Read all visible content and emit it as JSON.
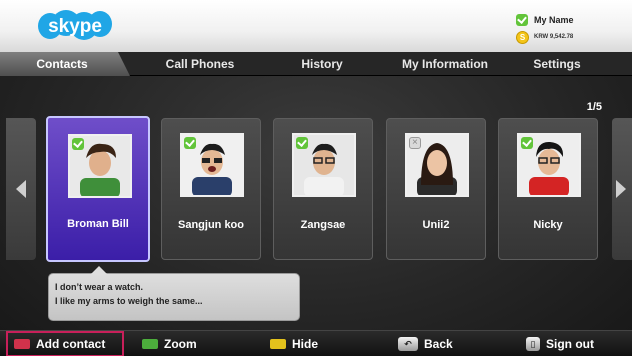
{
  "app": {
    "logo_text": "skype"
  },
  "user": {
    "name": "My Name",
    "credit": "KRW 9,542.78",
    "credit_symbol": "S"
  },
  "tabs": [
    {
      "label": "Contacts",
      "active": true
    },
    {
      "label": "Call Phones",
      "active": false
    },
    {
      "label": "History",
      "active": false
    },
    {
      "label": "My Information",
      "active": false
    },
    {
      "label": "Settings",
      "active": false
    }
  ],
  "page_indicator": "1/5",
  "contacts": [
    {
      "name": "Broman Bill",
      "status": "online",
      "selected": true,
      "shirt": "#3f8f3a",
      "bg": "#e9e9e9"
    },
    {
      "name": "Sangjun koo",
      "status": "online",
      "selected": false,
      "shirt": "#2a3f6a",
      "bg": "#f0f0f0"
    },
    {
      "name": "Zangsae",
      "status": "online",
      "selected": false,
      "shirt": "#f2f2f2",
      "bg": "#e7e7e7"
    },
    {
      "name": "Unii2",
      "status": "offline",
      "selected": false,
      "shirt": "#2b2b2b",
      "bg": "#ededed"
    },
    {
      "name": "Nicky",
      "status": "online",
      "selected": false,
      "shirt": "#d42424",
      "bg": "#eeeeee"
    }
  ],
  "mood": {
    "line1": "I don’t wear a watch.",
    "line2": "I like my arms to weigh the same..."
  },
  "bottom_bar": [
    {
      "label": "Add contact",
      "key": "red",
      "color": "#d0324b",
      "focused": true
    },
    {
      "label": "Zoom",
      "key": "green",
      "color": "#4cae3c",
      "focused": false
    },
    {
      "label": "Hide",
      "key": "yellow",
      "color": "#e3c21c",
      "focused": false
    },
    {
      "label": "Back",
      "key": "return",
      "icon": "back-arrow-icon",
      "focused": false
    },
    {
      "label": "Sign out",
      "key": "exit",
      "icon": "exit-door-icon",
      "focused": false
    }
  ]
}
